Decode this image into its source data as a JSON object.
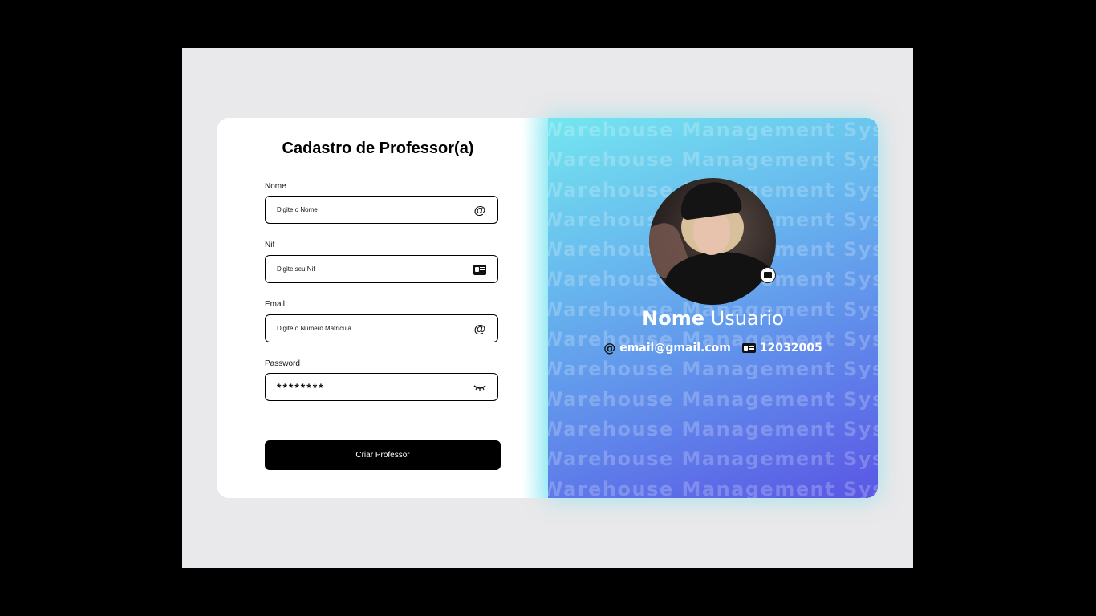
{
  "form": {
    "title": "Cadastro de Professor(a)",
    "fields": [
      {
        "label": "Nome",
        "placeholder": "Digite o Nome",
        "icon": "at-icon"
      },
      {
        "label": "Nif",
        "placeholder": "Digite seu Nif",
        "icon": "id-card-icon"
      },
      {
        "label": "Email",
        "placeholder": "Digite o Número Matrícula",
        "icon": "at-icon"
      },
      {
        "label": "Password",
        "value": "********",
        "icon": "eye-closed-icon"
      }
    ],
    "submit_label": "Criar Professor"
  },
  "profile": {
    "background_text": "Warehouse Management System",
    "first_name": "Nome",
    "last_name": "Usuario",
    "email": "email@gmail.com",
    "nif": "12032005"
  },
  "colors": {
    "gradient_start": "#74e6ef",
    "gradient_end": "#5a56e4",
    "button": "#000000"
  }
}
